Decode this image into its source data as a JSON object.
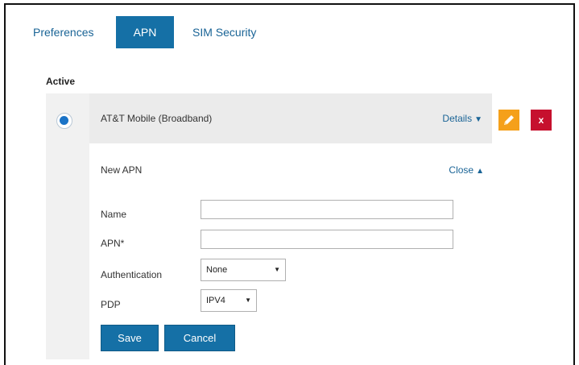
{
  "tabs": [
    {
      "label": "Preferences",
      "active": false
    },
    {
      "label": "APN",
      "active": true
    },
    {
      "label": "SIM Security",
      "active": false
    }
  ],
  "section": {
    "label": "Active"
  },
  "apn_entry": {
    "name": "AT&T Mobile (Broadband)",
    "details_label": "Details",
    "selected": true
  },
  "form": {
    "title": "New APN",
    "close_label": "Close",
    "fields": {
      "name_label": "Name",
      "name_value": "",
      "apn_label": "APN*",
      "apn_value": "",
      "auth_label": "Authentication",
      "auth_value": "None",
      "pdp_label": "PDP",
      "pdp_value": "IPV4"
    },
    "save_label": "Save",
    "cancel_label": "Cancel"
  },
  "colors": {
    "primary": "#1570a6",
    "link": "#1a6496",
    "edit": "#f5a01a",
    "delete": "#c6102e"
  },
  "icons": {
    "edit": "pencil-icon",
    "delete": "close-icon"
  }
}
